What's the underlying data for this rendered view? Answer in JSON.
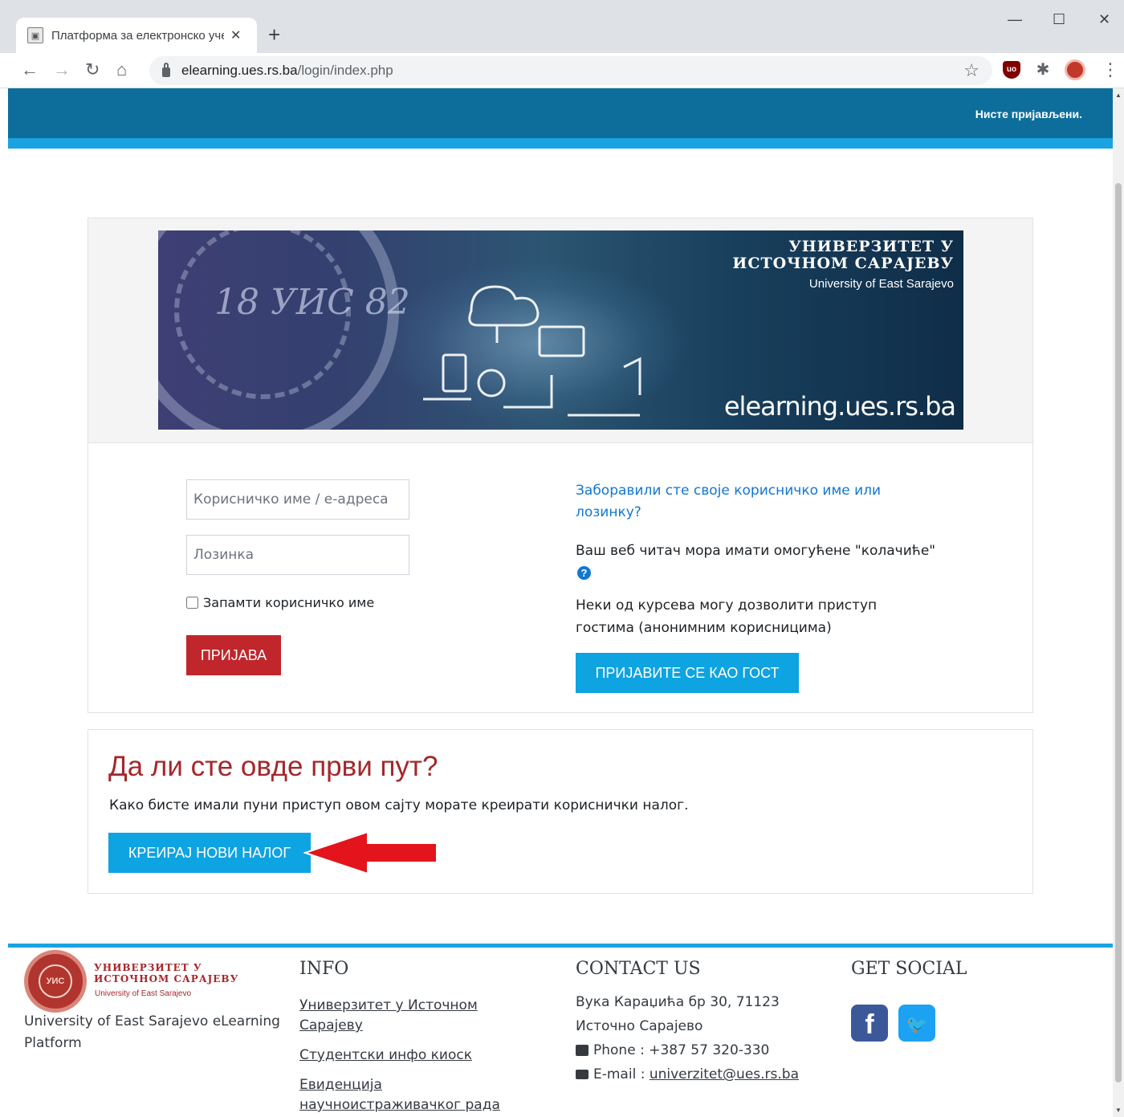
{
  "browser": {
    "tab_title": "Платформа за електронско уче",
    "tab_close": "✕",
    "new_tab": "+",
    "url_host": "elearning.ues.rs.ba",
    "url_path": "/login/index.php",
    "window_controls": {
      "minimize": "—",
      "maximize": "☐",
      "close": "✕"
    },
    "nav": {
      "back": "←",
      "forward": "→",
      "reload": "↻",
      "home": "⌂"
    }
  },
  "header": {
    "login_status": "Нисте пријављени.",
    "colors": {
      "navbar": "#0e6e9b",
      "strip": "#1aa3e0"
    }
  },
  "banner": {
    "university_cyr_line1": "УНИВЕРЗИТЕТ У",
    "university_cyr_line2": "ИСТОЧНОМ САРАЈЕВУ",
    "university_en": "University of East Sarajevo",
    "site_url": "elearning.ues.rs.ba",
    "seal_text": "18 УИС 82"
  },
  "login_form": {
    "username_placeholder": "Корисничко име / е-адреса",
    "password_placeholder": "Лозинка",
    "remember_label": "Запамти корисничко име",
    "login_button": "ПРИЈАВА",
    "forgot_link": "Заборавили сте своје корисничко име или лозинку?",
    "cookies_text": "Ваш веб читач мора имати омогућене \"колачиће\"",
    "guest_info": "Неки од курсева могу дозволити приступ гостима (анонимним корисницима)",
    "guest_button": "ПРИЈАВИТЕ СЕ КАО ГОСТ",
    "colors": {
      "login_button": "#c0262b",
      "guest_button": "#0ea3e1",
      "link": "#1177d1"
    }
  },
  "signup": {
    "title": "Да ли сте овде први пут?",
    "text": "Како бисте имали пуни приступ овом сајту морате креирати кориснички налог.",
    "button": "КРЕИРАЈ НОВИ НАЛОГ",
    "colors": {
      "title": "#a5272b",
      "arrow": "#e3141b"
    }
  },
  "footer": {
    "logo_cyr_line1": "УНИВЕРЗИТЕТ У",
    "logo_cyr_line2": "ИСТОЧНОМ САРАЈЕВУ",
    "logo_en": "University of East Sarajevo",
    "platform_text": "University of East Sarajevo eLearning Platform",
    "info_heading": "INFO",
    "info_links": [
      "Универзитет у Источном Сарајеву",
      "Студентски инфо киоск",
      "Евиденција научноистраживачког рада"
    ],
    "contact_heading": "CONTACT US",
    "address_line1": "Вука Караџића бр 30, 71123",
    "address_line2": "Источно Сарајево",
    "phone_label": "Phone : +387 57 320-330",
    "email_label": "E-mail : ",
    "email_value": "univerzitet@ues.rs.ba",
    "social_heading": "GET SOCIAL",
    "social_icons": [
      "facebook-icon",
      "twitter-icon"
    ]
  }
}
